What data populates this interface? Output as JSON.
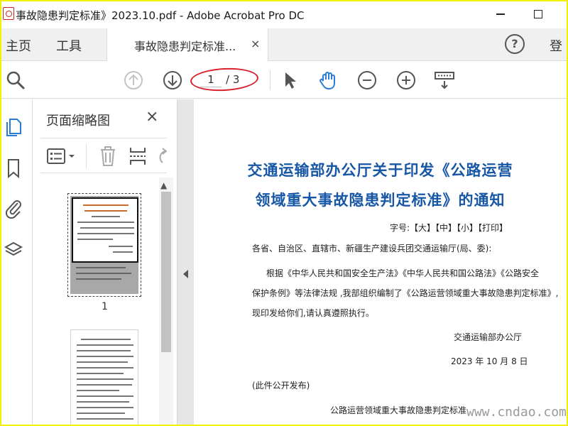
{
  "window": {
    "title": "事故隐患判定标准》2023.10.pdf - Adobe Acrobat Pro DC"
  },
  "tabs": {
    "home": "主页",
    "tools": "工具",
    "document": "事故隐患判定标准...",
    "close": "×",
    "help": "?",
    "login": "登"
  },
  "toolbar": {
    "current_page": "1",
    "total_pages": "/ 3"
  },
  "thumbnail_panel": {
    "title": "页面缩略图",
    "close": "×",
    "thumb1_number": "1"
  },
  "document": {
    "heading_line1": "交通运输部办公厅关于印发《公路运营",
    "heading_line2": "领域重大事故隐患判定标准》的通知",
    "font_size_line": "字号:【大】【中】【小】【打印】",
    "recipients": "各省、自治区、直辖市、新疆生产建设兵团交通运输厅(局、委):",
    "body_line1": "根据《中华人民共和国安全生产法》《中华人民共和国公路法》《公路安全",
    "body_line2": "保护条例》等法律法规 ,我部组织编制了《公路运营领域重大事故隐患判定标准》,",
    "body_line3": "现印发给你们,请认真遵照执行。",
    "signature": "交通运输部办公厅",
    "date": "2023 年 10 月 8 日",
    "note": "(此件公开发布)",
    "attachment_title": "公路运营领域重大事故隐患判定标准"
  },
  "watermark": "www.cndao.com",
  "colors": {
    "heading": "#1757a6",
    "annotation": "#d8202a",
    "frame": "#f2f200",
    "accent": "#2b7bd8"
  }
}
